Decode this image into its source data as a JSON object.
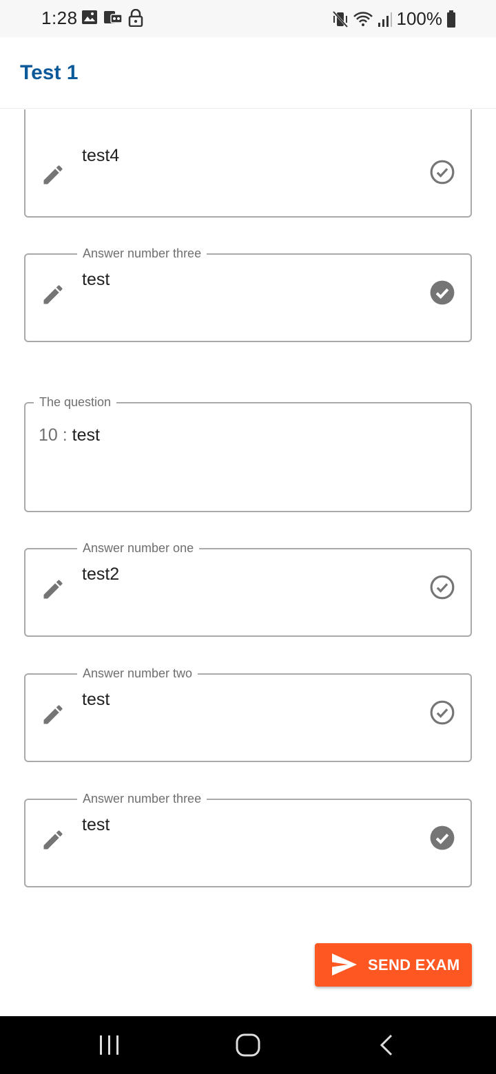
{
  "status_bar": {
    "time": "1:28",
    "battery": "100%",
    "left_icons": [
      "image-icon",
      "voicemail-icon",
      "lock-icon"
    ],
    "right_icons": [
      "vibrate-mute-icon",
      "wifi-icon",
      "signal-icon",
      "battery-icon"
    ]
  },
  "app_bar": {
    "title": "Test 1",
    "title_color": "#0d5a9a"
  },
  "cards": [
    {
      "label": "",
      "value": "test4",
      "checked": false
    },
    {
      "label": "Answer number three",
      "value": "test",
      "checked": true
    },
    {
      "label": "Answer number one",
      "value": "test2",
      "checked": false
    },
    {
      "label": "Answer number two",
      "value": "test",
      "checked": false
    },
    {
      "label": "Answer number three",
      "value": "test",
      "checked": true
    }
  ],
  "question": {
    "label": "The question",
    "number": "10 :",
    "text": "test"
  },
  "send_button": {
    "label": "SEND EXAM",
    "color": "#ff5722"
  },
  "nav_bar": {
    "icons": [
      "recent-apps-icon",
      "home-icon",
      "back-icon"
    ]
  }
}
